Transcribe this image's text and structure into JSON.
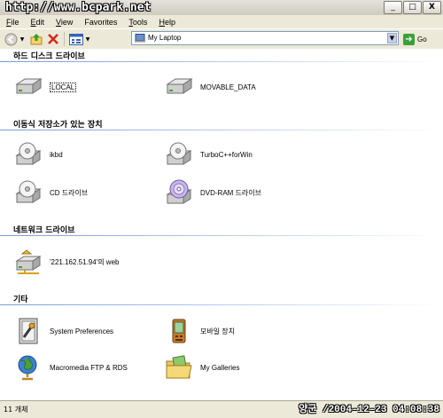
{
  "watermark": "http://www.bcpark.net",
  "window_buttons": [
    "_",
    "□",
    "X"
  ],
  "menu": {
    "items": [
      {
        "key": "F",
        "rest": "ile"
      },
      {
        "key": "E",
        "rest": "dit"
      },
      {
        "key": "V",
        "rest": "iew"
      },
      {
        "key": "",
        "rest": "Favorites"
      },
      {
        "key": "T",
        "rest": "ools"
      },
      {
        "key": "H",
        "rest": "elp"
      }
    ]
  },
  "toolbar": {
    "address_value": "My Laptop",
    "go_label": "Go"
  },
  "groups": {
    "hard_disk": {
      "title": "하드 디스크 드라이브",
      "items": [
        {
          "label": "LOCAL",
          "icon": "hard-drive-icon"
        },
        {
          "label": "MOVABLE_DATA",
          "icon": "hard-drive-icon"
        }
      ]
    },
    "removable": {
      "title": "이동식 저장소가 있는 장치",
      "items": [
        {
          "label": "ikbd",
          "icon": "disk-drive-icon"
        },
        {
          "label": "TurboC++forWin",
          "icon": "disk-drive-icon"
        },
        {
          "label": "CD 드라이브",
          "icon": "disk-drive-icon"
        },
        {
          "label": "DVD-RAM 드라이브",
          "icon": "dvd-drive-icon"
        }
      ]
    },
    "network": {
      "title": "네트워크 드라이브",
      "items": [
        {
          "label": "'221.162.51.94'의 web",
          "icon": "network-drive-icon"
        }
      ]
    },
    "other": {
      "title": "기타",
      "items": [
        {
          "label": "System Preferences",
          "icon": "system-preferences-icon"
        },
        {
          "label": "모바일 장치",
          "icon": "mobile-device-icon"
        },
        {
          "label": "Macromedia FTP & RDS",
          "icon": "globe-icon"
        },
        {
          "label": "My Galleries",
          "icon": "folder-icon"
        }
      ]
    }
  },
  "status": {
    "count_text": "11 개체",
    "stamp": "양군 /2004-12-23 04:08:38"
  }
}
